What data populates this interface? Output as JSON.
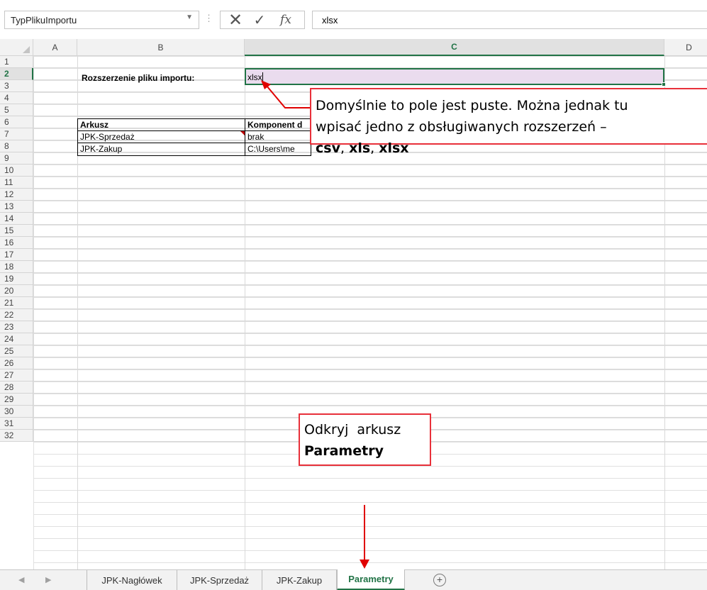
{
  "formula_bar": {
    "name_box": "TypPlikuImportu",
    "cancel_symbol": "✕",
    "enter_symbol": "✓",
    "fx_label": "fx",
    "formula_value": "xlsx"
  },
  "columns": [
    "A",
    "B",
    "C",
    "D"
  ],
  "active_column": "C",
  "rows": [
    "1",
    "2",
    "3",
    "4",
    "5",
    "6",
    "7",
    "8",
    "9",
    "10",
    "11",
    "12",
    "13",
    "14",
    "15",
    "16",
    "17",
    "18",
    "19",
    "20",
    "21",
    "22",
    "23",
    "24",
    "25",
    "26",
    "27",
    "28",
    "29",
    "30",
    "31",
    "32"
  ],
  "active_row": "2",
  "cells": {
    "B2": "Rozszerzenie pliku importu:",
    "C2": "xlsx",
    "B5": "Arkusz",
    "C5": "Komponent d",
    "B6": "JPK-Sprzedaż",
    "C6": "brak",
    "B7": "JPK-Zakup",
    "C7": "C:\\Users\\me"
  },
  "callouts": {
    "extension": {
      "line1": "Domyślnie to pole jest puste. Można jednak tu",
      "line2": "wpisać jedno z obsługiwanych rozszerzeń –",
      "ext_csv": "csv",
      "ext_xls": "xls",
      "ext_xlsx": "xlsx",
      "sep": ", "
    },
    "unhide": {
      "line1": "Odkryj arkusz",
      "line2": "Parametry"
    }
  },
  "sheet_tabs": [
    {
      "label": "JPK-Nagłówek",
      "active": false
    },
    {
      "label": "JPK-Sprzedaż",
      "active": false
    },
    {
      "label": "JPK-Zakup",
      "active": false
    },
    {
      "label": "Parametry",
      "active": true
    }
  ],
  "colors": {
    "accent": "#217346",
    "callout_border": "#e8303a",
    "selection_fill": "#eadcee",
    "arrow": "#e00000"
  }
}
